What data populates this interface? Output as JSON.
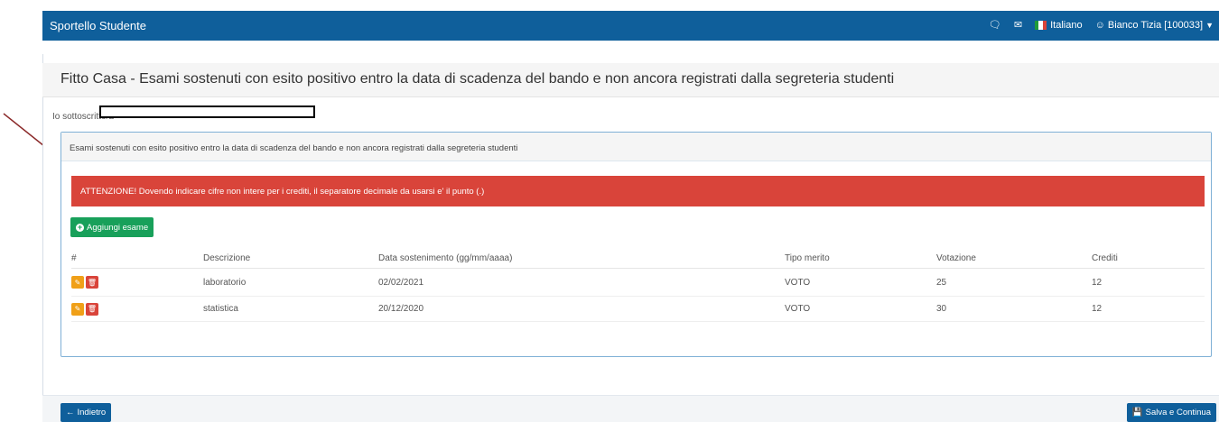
{
  "navbar": {
    "brand": "Sportello Studente",
    "chat_icon": "comment-icon",
    "mail_icon": "envelope-icon",
    "language": "Italiano",
    "user": "Bianco Tizia [100033]",
    "color": "#0f5f9b"
  },
  "page": {
    "title": "Fitto Casa - Esami sostenuti con esito positivo entro la data di scadenza del bando e non ancora registrati dalla segreteria studenti",
    "subline": "Io sottoscritto/a"
  },
  "panel": {
    "heading": "Esami sostenuti con esito positivo entro la data di scadenza del bando e non ancora registrati dalla segreteria studenti",
    "alert": "ATTENZIONE! Dovendo indicare cifre non intere per i crediti, il separatore decimale da usarsi e' il punto (.)",
    "add_button": "Aggiungi esame",
    "columns": [
      "#",
      "Descrizione",
      "Data sostenimento (gg/mm/aaaa)",
      "Tipo merito",
      "Votazione",
      "Crediti"
    ],
    "rows": [
      {
        "descrizione": "laboratorio",
        "data": "02/02/2021",
        "tipo": "VOTO",
        "voto": "25",
        "crediti": "12"
      },
      {
        "descrizione": "statistica",
        "data": "20/12/2020",
        "tipo": "VOTO",
        "voto": "30",
        "crediti": "12"
      }
    ]
  },
  "footer": {
    "back": "Indietro",
    "save": "Salva e Continua"
  },
  "colors": {
    "alert": "#d9443a",
    "success": "#18a05a",
    "edit": "#f0a018",
    "arrow": "#8b2a2a"
  }
}
